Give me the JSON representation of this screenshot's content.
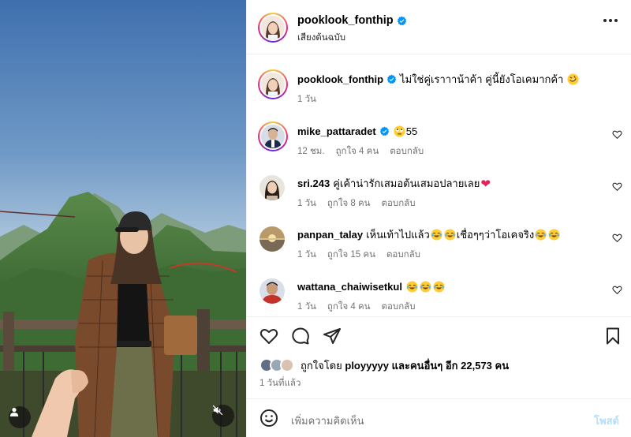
{
  "post": {
    "username": "pooklook_fonthip",
    "audio_label": "เสียงต้นฉบับ",
    "caption": "ไม่ใช่คู่เราาาน้าค้า คู่นี้ยังโอเคมากค้า",
    "caption_time": "1 วัน"
  },
  "comments": [
    {
      "username": "mike_pattaradet",
      "verified": true,
      "text": "55",
      "time": "12 ชม.",
      "likes": "ถูกใจ 4 คน",
      "reply": "ตอบกลับ"
    },
    {
      "username": "sri.243",
      "verified": false,
      "text": "คู่เค้าน่ารักเสมอต้นเสมอปลายเลย",
      "time": "1 วัน",
      "likes": "ถูกใจ 8 คน",
      "reply": "ตอบกลับ"
    },
    {
      "username": "panpan_talay",
      "verified": false,
      "text_a": "เห็นเท้าไปแล้ว",
      "text_b": "เชื่อๆๆว่าโอเคจริง",
      "time": "1 วัน",
      "likes": "ถูกใจ 15 คน",
      "reply": "ตอบกลับ"
    },
    {
      "username": "wattana_chaiwisetkul",
      "verified": false,
      "text": "",
      "time": "1 วัน",
      "likes": "ถูกใจ 4 คน",
      "reply": "ตอบกลับ"
    }
  ],
  "likes": {
    "prefix": "ถูกใจโดย",
    "by_user": "ployyyyy",
    "suffix": "และคนอื่นๆ อีก 22,573 คน"
  },
  "posted_time": "1 วันที่แล้ว",
  "composer": {
    "placeholder": "เพิ่มความคิดเห็น",
    "post_label": "โพสต์"
  },
  "colors": {
    "verified": "#0095f6",
    "post_button_disabled": "#b2dffc",
    "meta_text": "#737373"
  }
}
